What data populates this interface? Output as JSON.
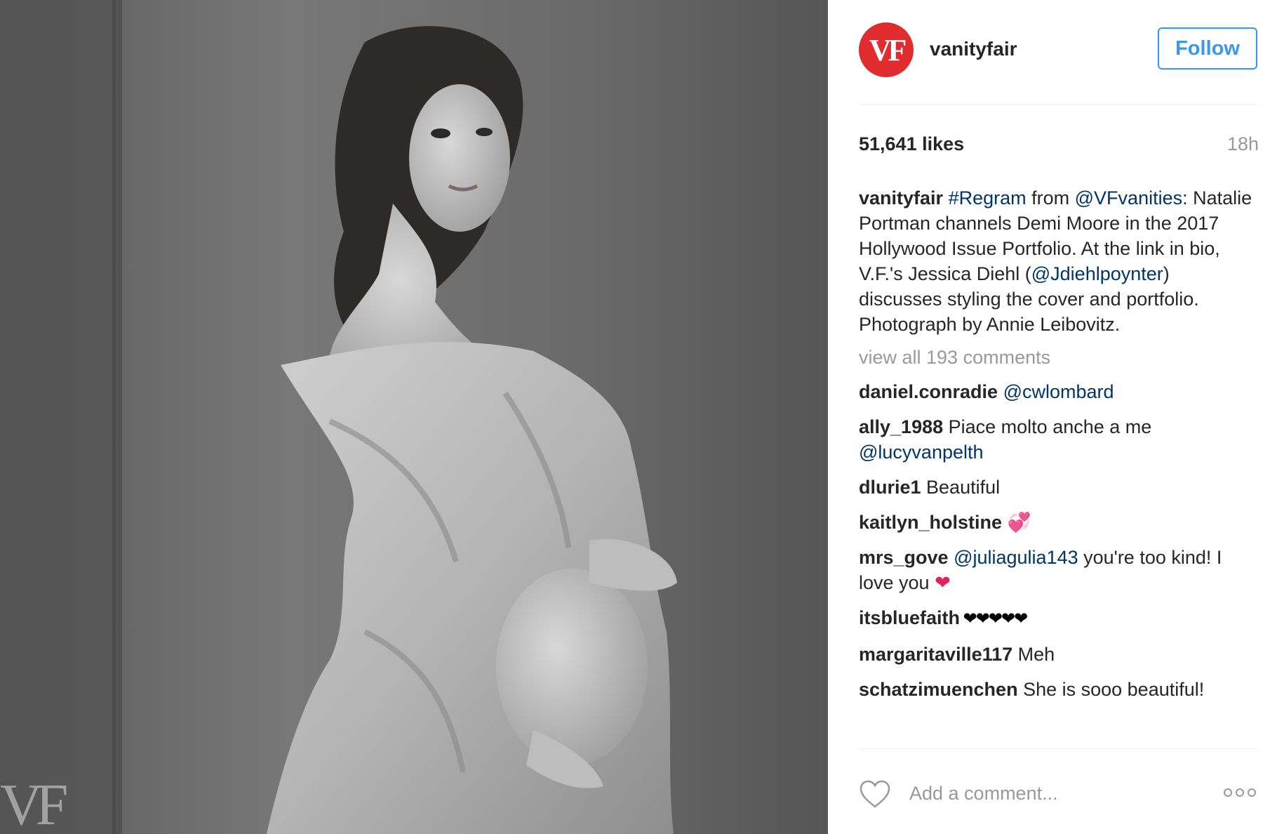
{
  "photo": {
    "watermark": "VF"
  },
  "post": {
    "avatar_text": "VF",
    "username": "vanityfair",
    "follow_label": "Follow",
    "likes": "51,641 likes",
    "time": "18h"
  },
  "caption": {
    "user": "vanityfair",
    "hashtag": "#Regram",
    "from_word": " from ",
    "mention": "@VFvanities",
    "text1": ": Natalie Portman channels Demi Moore in the 2017 Hollywood Issue Portfolio. At the link in bio, V.F.'s Jessica Diehl (",
    "mention2": "@Jdiehlpoynter",
    "text2": ") discusses styling the cover and portfolio. Photograph by Annie Leibovitz."
  },
  "view_all": "view all 193 comments",
  "comments": [
    {
      "user": "daniel.conradie",
      "mention": "@cwlombard"
    },
    {
      "user": "ally_1988",
      "text": " Piace molto anche a me ",
      "mention": "@lucyvanpelth"
    },
    {
      "user": "dlurie1",
      "text": " Beautiful"
    },
    {
      "user": "kaitlyn_holstine",
      "emoji": " 💞"
    },
    {
      "user": "mrs_gove",
      "mention": " @juliagulia143",
      "text": " you're too kind! I love you",
      "emoji": " ❤"
    },
    {
      "user": "itsbluefaith",
      "emoji": " ❤❤❤❤❤"
    },
    {
      "user": "margaritaville117",
      "text": " Meh"
    },
    {
      "user": "schatzimuenchen",
      "text": " She is sooo beautiful!"
    }
  ],
  "comment_bar": {
    "placeholder": "Add a comment...",
    "like_icon": "heart-outline-icon",
    "more_icon": "ellipsis-icon"
  },
  "colors": {
    "accent": "#3897f0",
    "mention": "#003569",
    "muted": "#999999",
    "avatar_bg": "#e02b2f",
    "text": "#262626"
  }
}
